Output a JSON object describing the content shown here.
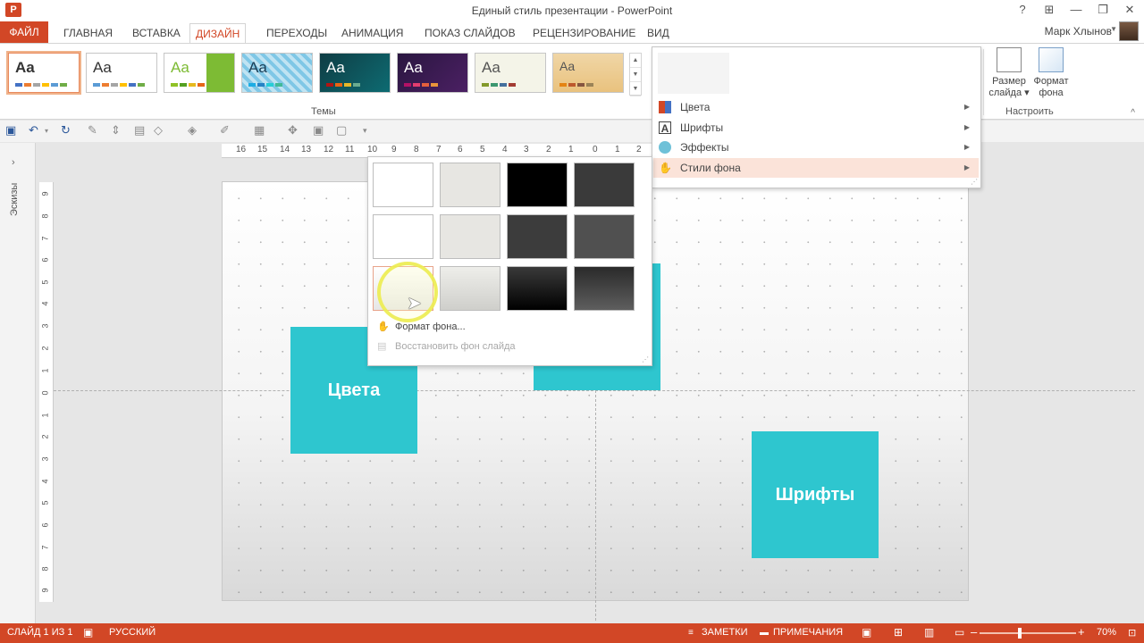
{
  "window": {
    "title": "Единый стиль презентации - PowerPoint",
    "app_icon": "P",
    "controls": [
      "?",
      "⊞",
      "—",
      "❐",
      "✕"
    ]
  },
  "tabs": {
    "file": "ФАЙЛ",
    "items": [
      "ГЛАВНАЯ",
      "ВСТАВКА",
      "ДИЗАЙН",
      "ПЕРЕХОДЫ",
      "АНИМАЦИЯ",
      "ПОКАЗ СЛАЙДОВ",
      "РЕЦЕНЗИРОВАНИЕ",
      "ВИД"
    ],
    "active": "ДИЗАЙН",
    "user": "Марк Хлынов"
  },
  "ribbon": {
    "themes_label": "Темы",
    "theme_sample": "Aa",
    "customize_label": "Настроить",
    "slide_size_label": "Размер слайда",
    "format_bg_label": "Формат фона"
  },
  "menu": {
    "items": [
      {
        "label": "Цвета",
        "icon": "colors-icon"
      },
      {
        "label": "Шрифты",
        "icon": "fonts-icon"
      },
      {
        "label": "Эффекты",
        "icon": "effects-icon"
      },
      {
        "label": "Стили фона",
        "icon": "background-styles-icon"
      }
    ],
    "hovered": "Стили фона"
  },
  "bg_gallery": {
    "swatches": [
      [
        "#ffffff",
        "#e7e6e2",
        "#000000",
        "#3a3a3a"
      ],
      [
        "#ffffff",
        "#e7e6e2",
        "#3c3c3c",
        "#505050"
      ],
      [
        "gradient-white",
        "gradient-light",
        "gradient-black",
        "gradient-dark"
      ]
    ],
    "format_bg": "Формат фона...",
    "reset_bg": "Восстановить фон слайда"
  },
  "slide": {
    "box_colors": "Цвета",
    "box_fonts": "Шрифты",
    "accent_color": "#2ec6cf"
  },
  "left_panel": {
    "label": "Эскизы"
  },
  "ruler": {
    "h_ticks": [
      "16",
      "15",
      "14",
      "13",
      "12",
      "11",
      "10",
      "9",
      "8",
      "7",
      "6",
      "5",
      "4",
      "3",
      "2",
      "1",
      "0",
      "1",
      "2"
    ],
    "v_ticks": [
      "9",
      "8",
      "7",
      "6",
      "5",
      "4",
      "3",
      "2",
      "1",
      "0",
      "1",
      "2",
      "3",
      "4",
      "5",
      "6",
      "7",
      "8",
      "9"
    ]
  },
  "statusbar": {
    "slide": "СЛАЙД 1 ИЗ 1",
    "language": "РУССКИЙ",
    "notes": "ЗАМЕТКИ",
    "comments": "ПРИМЕЧАНИЯ",
    "zoom": "70%",
    "zoom_level": 0.4
  }
}
